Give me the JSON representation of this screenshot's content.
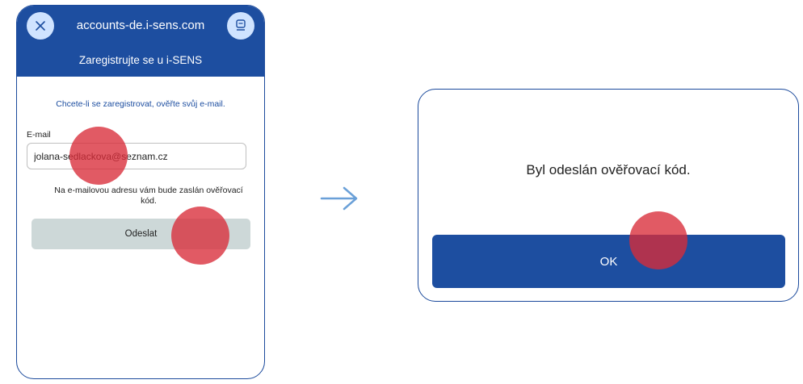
{
  "phone": {
    "domain": "accounts-de.i-sens.com",
    "subtitle": "Zaregistrujte se u i-SENS",
    "close_icon": "close-icon",
    "right_icon": "device-icon",
    "instruction": "Chcete-li se zaregistrovat, ověřte svůj e-mail.",
    "email_label": "E-mail",
    "email_value": "jolana-sedlackova@seznam.cz",
    "note": "Na e-mailovou adresu vám bude zaslán ověřovací kód.",
    "send_label": "Odeslat"
  },
  "dialog": {
    "message": "Byl odeslán ověřovací kód.",
    "ok_label": "OK"
  },
  "colors": {
    "brand_blue": "#1d4ea0",
    "tap_marker": "#d82c38",
    "send_button_bg": "#cdd8d8"
  }
}
